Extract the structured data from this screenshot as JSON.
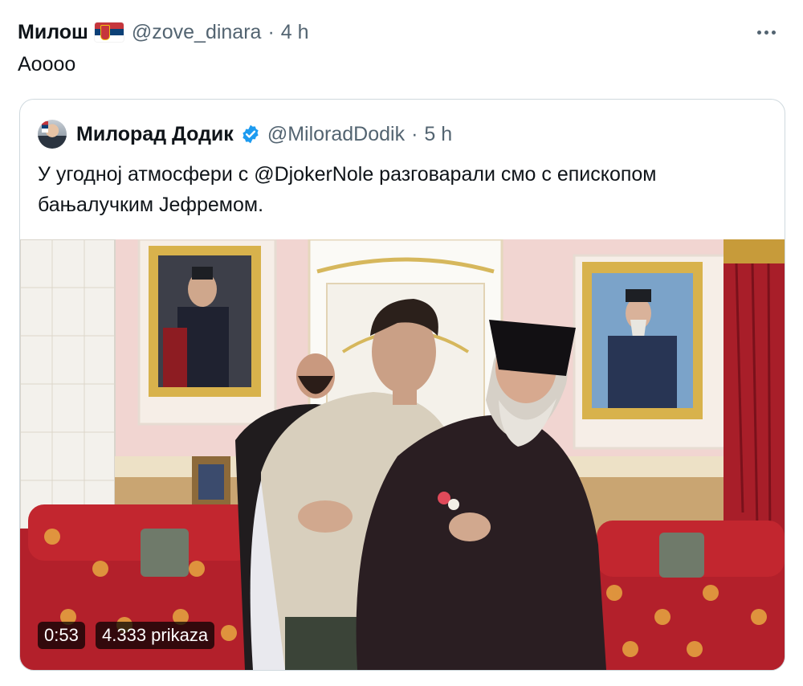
{
  "post": {
    "author_name": "Милош",
    "flag_icon": "serbia-flag-icon",
    "handle": "@zove_dinara",
    "separator": "·",
    "time": "4 h",
    "text": "Aoooo"
  },
  "quoted_post": {
    "author_name": "Милорад Додик",
    "handle": "@MiloradDodik",
    "separator": "·",
    "time": "5 h",
    "text_line1_before": "У угодној атмосфери с ",
    "mention": "@DjokerNole",
    "text_line1_after": " разговарали смо с епископом",
    "text_line2": "бањалучким Јефремом.",
    "verified_color": "#1d9bf0"
  },
  "video": {
    "duration": "0:53",
    "views": "4.333 prikaza"
  }
}
